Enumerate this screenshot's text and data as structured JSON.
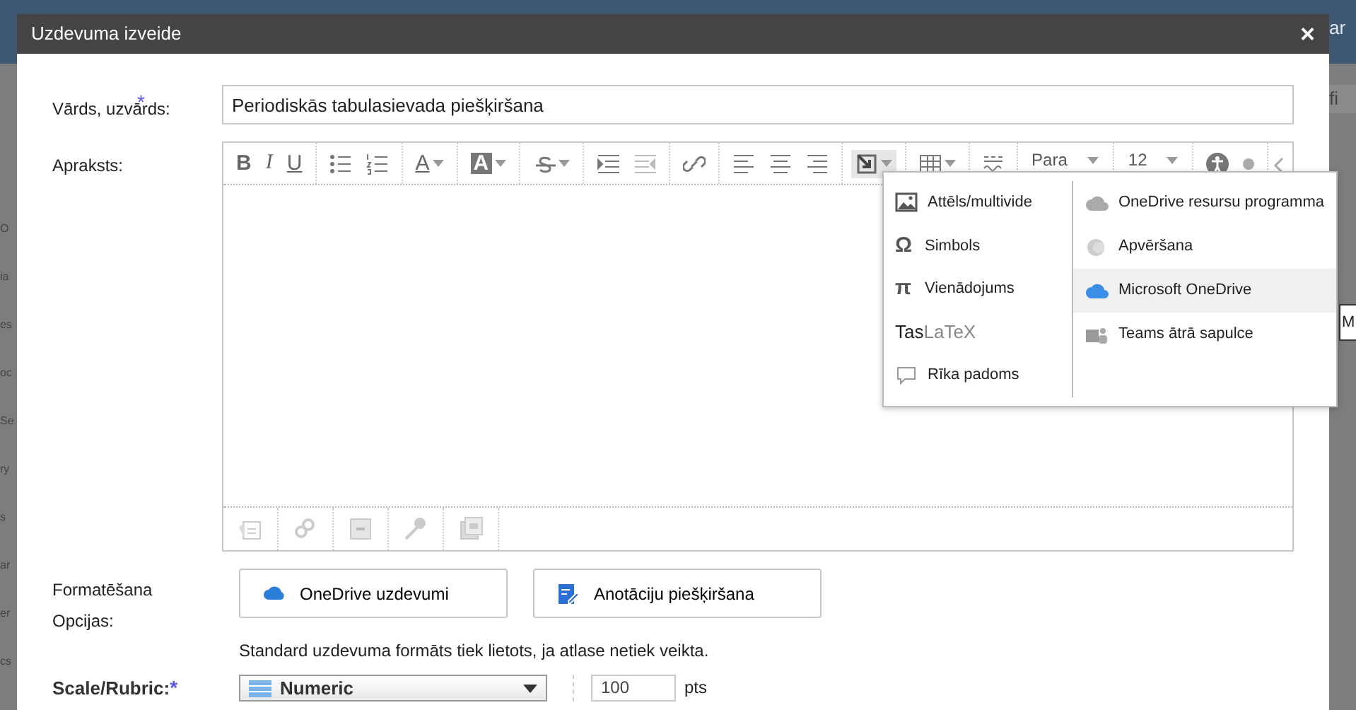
{
  "background": {
    "left_fragments": [
      "O",
      "ia",
      "es",
      "oc",
      "Se",
      "ry",
      "s",
      "ar",
      "er",
      "cs"
    ],
    "right_fragments": [
      "ar",
      "fi"
    ],
    "tooltip": "M"
  },
  "window": {
    "title": "Uzdevuma izveide",
    "close": "×"
  },
  "name_field": {
    "label": "Vārds, uzvārds:",
    "required_mark": "*",
    "value": "Periodiskās tabulasievada piešķiršana"
  },
  "description": {
    "label": "Apraksts:",
    "toolbar_groups": [
      {
        "tools": [
          {
            "kind": "glyph",
            "glyph": "B"
          },
          {
            "kind": "glyph",
            "glyph": "I"
          },
          {
            "kind": "glyph",
            "glyph": "U"
          }
        ]
      },
      {
        "tools": [
          {
            "kind": "icon"
          },
          {
            "kind": "icon"
          }
        ]
      },
      {
        "tools": [
          {
            "kind": "glyph",
            "glyph": "A",
            "caret": true
          }
        ]
      },
      {
        "tools": [
          {
            "kind": "glyph",
            "glyph": "A",
            "caret": true
          }
        ]
      },
      {
        "tools": [
          {
            "kind": "icon",
            "caret": true
          }
        ]
      },
      {
        "tools": [
          {
            "kind": "icon"
          },
          {
            "kind": "icon"
          }
        ]
      },
      {
        "tools": [
          {
            "kind": "icon"
          }
        ]
      },
      {
        "tools": [
          {
            "kind": "icon"
          },
          {
            "kind": "icon"
          },
          {
            "kind": "icon"
          }
        ]
      },
      {
        "tools": [
          {
            "kind": "icon",
            "caret": true,
            "expanded": true
          }
        ]
      },
      {
        "tools": [
          {
            "kind": "icon",
            "caret": true
          }
        ]
      },
      {
        "tools": [
          {
            "kind": "icon"
          }
        ]
      },
      {
        "tools": [
          {
            "kind": "select",
            "text": "Para"
          }
        ]
      },
      {
        "tools": [
          {
            "kind": "select",
            "text": "12"
          }
        ]
      },
      {
        "tools": [
          {
            "kind": "icon"
          },
          {
            "kind": "icon"
          }
        ]
      }
    ],
    "bottom_tools": [
      {
        "disabled": true
      },
      {
        "disabled": true
      },
      {
        "disabled": true
      },
      {
        "disabled": true
      },
      {
        "disabled": true
      }
    ],
    "insert_menu": {
      "left": [
        {
          "kind": "icon",
          "label": "Attēls/multivide"
        },
        {
          "kind": "glyph",
          "glyph": "Ω",
          "label": "Simbols"
        },
        {
          "kind": "glyph",
          "glyph": "π",
          "label": "Vienādojums"
        },
        {
          "kind": "latex",
          "label": "Tas",
          "suffix": "LaTeX"
        },
        {
          "kind": "icon",
          "label": "Rīka padoms"
        }
      ],
      "right": [
        {
          "label": "OneDrive resursu programma",
          "selected": false
        },
        {
          "label": "Apvēršana",
          "selected": false
        },
        {
          "label": "Microsoft OneDrive",
          "selected": true
        },
        {
          "label": "Teams ātrā sapulce",
          "selected": false
        }
      ]
    }
  },
  "formatting": {
    "label_lines": [
      "Formatēšana",
      "Opcijas:"
    ],
    "options": [
      "OneDrive uzdevumi",
      "Anotāciju piešķiršana"
    ],
    "help": "Standard uzdevuma formāts tiek lietots, ja atlase netiek veikta."
  },
  "scale": {
    "label": "Scale/Rubric:",
    "required_mark": "*",
    "select": "Numeric",
    "points": "100",
    "unit": "pts"
  }
}
